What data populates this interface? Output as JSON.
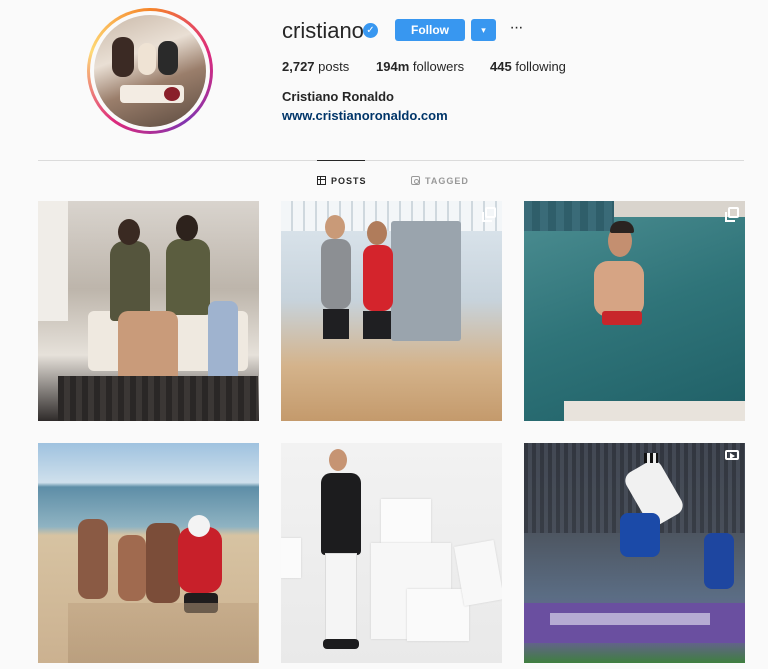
{
  "profile": {
    "username": "cristiano",
    "verified_icon": "verified-badge-icon",
    "follow_label": "Follow",
    "dropdown_icon": "▾",
    "more_icon": "···",
    "full_name": "Cristiano Ronaldo",
    "website": "www.cristianoronaldo.com"
  },
  "stats": {
    "posts_count": "2,727",
    "posts_label": "posts",
    "followers_count": "194m",
    "followers_label": "followers",
    "following_count": "445",
    "following_label": "following"
  },
  "tabs": [
    {
      "label": "POSTS",
      "icon": "grid-icon",
      "active": true
    },
    {
      "label": "TAGGED",
      "icon": "tag-icon",
      "active": false
    }
  ],
  "posts": [
    {
      "description": "couple-in-vehicle",
      "badge": "none"
    },
    {
      "description": "gym-two-men",
      "badge": "multiple-photos-icon"
    },
    {
      "description": "pool-man",
      "badge": "multiple-photos-icon"
    },
    {
      "description": "beach-santa-family",
      "badge": "none"
    },
    {
      "description": "studio-portrait",
      "badge": "none"
    },
    {
      "description": "football-bicycle-kick",
      "badge": "video-icon"
    }
  ],
  "colors": {
    "accent": "#3897f0",
    "link": "#003569",
    "background": "#fafafa",
    "divider": "#dbdbdb"
  }
}
